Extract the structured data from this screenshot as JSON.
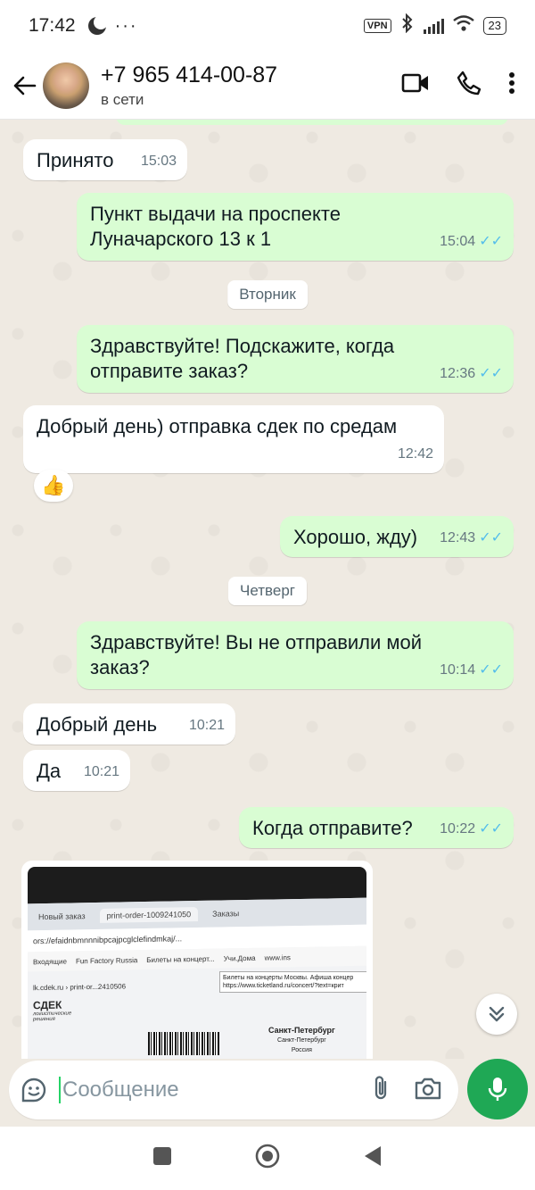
{
  "status_bar": {
    "time": "17:42",
    "more": "···",
    "vpn": "VPN",
    "battery": "23"
  },
  "header": {
    "name": "+7 965 414-00-87",
    "status": "в сети"
  },
  "messages": [
    {
      "dir": "in",
      "text": "Принято",
      "time": "15:03"
    },
    {
      "dir": "out",
      "text": "Пункт выдачи на проспекте Луначарского 13 к 1",
      "time": "15:04"
    },
    {
      "dir": "day",
      "text": "Вторник"
    },
    {
      "dir": "out",
      "text": "Здравствуйте! Подскажите, когда отправите заказ?",
      "time": "12:36"
    },
    {
      "dir": "in",
      "text": "Добрый день) отправка сдек по средам",
      "time": "12:42",
      "reaction": "👍"
    },
    {
      "dir": "out",
      "text": "Хорошо, жду)",
      "time": "12:43"
    },
    {
      "dir": "day",
      "text": "Четверг"
    },
    {
      "dir": "out",
      "text": "Здравствуйте! Вы не отправили мой заказ?",
      "time": "10:14"
    },
    {
      "dir": "in",
      "text": "Добрый день",
      "time": "10:21"
    },
    {
      "dir": "in",
      "text": "Да",
      "time": "10:21"
    },
    {
      "dir": "out",
      "text": "Когда отправите?",
      "time": "10:22"
    }
  ],
  "photo": {
    "tabs": [
      "Новый заказ",
      "print-order-1009241050",
      "Заказы"
    ],
    "url": "ors://efaidnbmnnnibpcajpcglclefindmkaj/...",
    "bookmarks": [
      "Входящие",
      "Fun Factory Russia",
      "Билеты на концерт...",
      "Учи.Дома",
      "www.ins"
    ],
    "tooltip_line1": "Билеты на концерты Москвы. Афиша концер",
    "tooltip_line2": "https://www.ticketland.ru/concert/?text=крит",
    "page_path": "lk.cdek.ru  ›  print-or...2410506",
    "cdek_logo": "СДЕК",
    "cdek_sub": "логистические решения",
    "city_line1": "Санкт-Петербург",
    "city_line2": "Санкт-Петербург",
    "city_line3": "Россия"
  },
  "composer": {
    "placeholder": "Сообщение"
  },
  "colors": {
    "outgoing": "#d9fdd3",
    "incoming": "#ffffff",
    "accent": "#1fa855",
    "ticks": "#53bdeb"
  }
}
